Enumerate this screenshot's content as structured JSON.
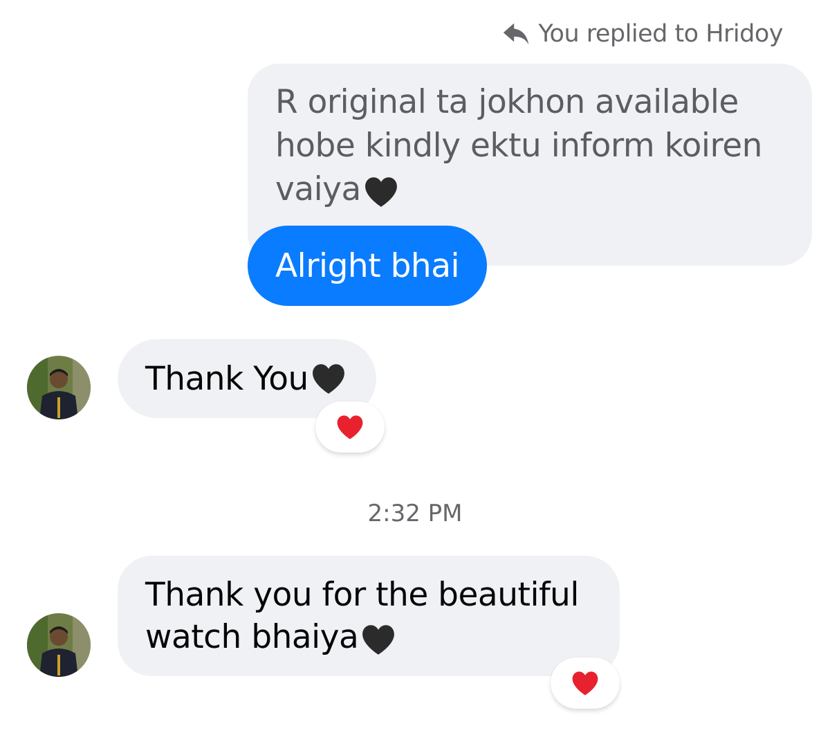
{
  "reply_header": {
    "text": "You replied to Hridoy",
    "icon": "reply-arrow-icon"
  },
  "quoted_message": {
    "text": "R original ta jokhon available hobe kindly ektu inform koiren vaiya",
    "emoji": "black-heart-icon"
  },
  "sent_message": {
    "text": "Alright bhai"
  },
  "messages": [
    {
      "text": "Thank You",
      "emoji": "black-heart-icon",
      "reaction": "red-heart-icon"
    },
    {
      "text": "Thank you for the beautiful watch bhaiya",
      "emoji": "black-heart-icon",
      "reaction": "red-heart-icon"
    }
  ],
  "timestamp": "2:32 PM",
  "colors": {
    "sent_bubble": "#0a7cff",
    "received_bubble": "#f0f1f5",
    "reaction_heart": "#e8212e",
    "black_heart": "#2b2b2b"
  }
}
